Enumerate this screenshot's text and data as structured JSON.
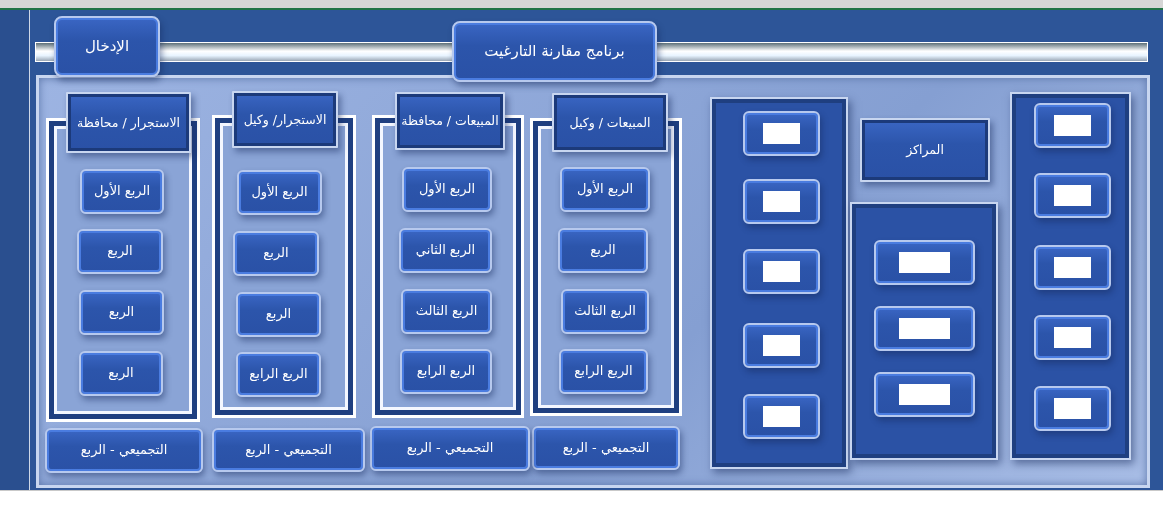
{
  "title_button": {
    "label": "برنامج مقارنة التارغيت"
  },
  "entry_button": {
    "label": "الإدخال"
  },
  "quarter_groups": [
    {
      "header": "المبيعات / وكيل",
      "buttons": [
        "الربع الأول",
        "الربع",
        "الربع الثالث",
        "الربع الرابع"
      ],
      "summary": "التجميعي - الربع"
    },
    {
      "header": "المبيعات / محافظة",
      "buttons": [
        "الربع الأول",
        "الربع الثاني",
        "الربع الثالث",
        "الربع الرابع"
      ],
      "summary": "التجميعي - الربع"
    },
    {
      "header": "الاستجرار/ وكيل",
      "buttons": [
        "الربع الأول",
        "الربع",
        "الربع",
        "الربع الرابع"
      ],
      "summary": "التجميعي - الربع"
    },
    {
      "header": "الاستجرار / محافظة",
      "buttons": [
        "الربع الأول",
        "الربع",
        "الربع",
        "الربع"
      ],
      "summary": "التجميعي - الربع"
    }
  ],
  "centers_label": "المراكز",
  "redacted_panels": [
    {
      "buttons": [
        {
          "kind": "redacted"
        },
        {
          "kind": "redacted"
        },
        {
          "kind": "redacted"
        },
        {
          "kind": "redacted"
        },
        {
          "kind": "redacted"
        }
      ]
    },
    {
      "buttons": [
        {
          "kind": "redacted"
        },
        {
          "kind": "redacted"
        },
        {
          "kind": "redacted"
        }
      ]
    },
    {
      "buttons": [
        {
          "kind": "redacted"
        },
        {
          "kind": "redacted"
        },
        {
          "kind": "redacted"
        },
        {
          "kind": "redacted"
        },
        {
          "kind": "redacted"
        }
      ]
    }
  ]
}
